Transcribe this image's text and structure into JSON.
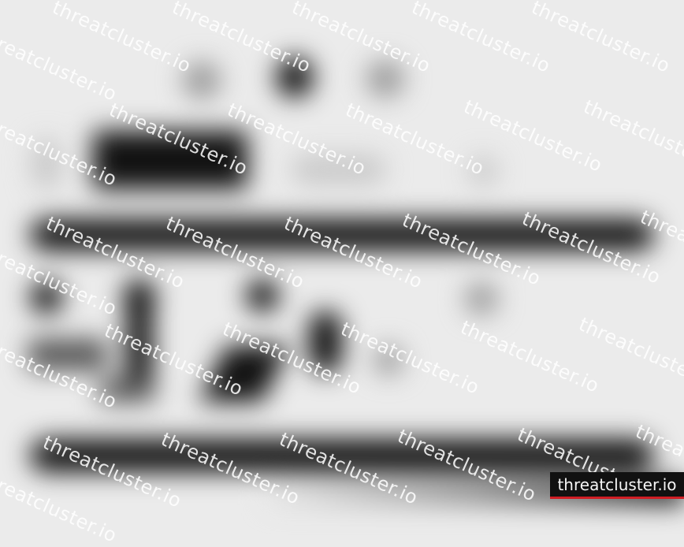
{
  "watermark": {
    "text": "threatcluster.io",
    "badge_text": "threatcluster.io",
    "badge_color": "#111111",
    "accent_color": "#d01d24"
  }
}
